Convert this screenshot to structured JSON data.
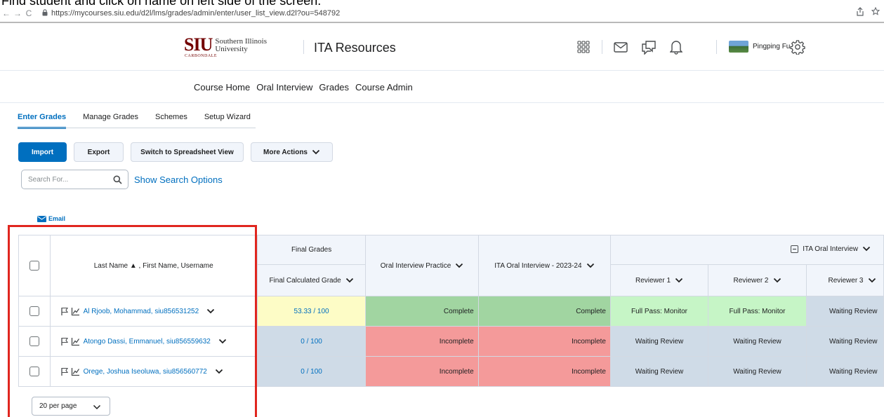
{
  "caption": "Find student and click on name on left side of the screen.",
  "browser": {
    "back": "←",
    "forward": "→",
    "reload": "C",
    "url": "https://mycourses.siu.edu/d2l/lms/grades/admin/enter/user_list_view.d2l?ou=548792"
  },
  "header": {
    "logo_main": "SIU",
    "logo_sub": "CARBONDALE",
    "logo_line1": "Southern Illinois",
    "logo_line2": "University",
    "course_name": "ITA Resources",
    "user_name": "Pingping Fu"
  },
  "navbar": {
    "items": [
      "Course Home",
      "Oral Interview",
      "Grades",
      "Course Admin"
    ]
  },
  "subtabs": {
    "items": [
      "Enter Grades",
      "Manage Grades",
      "Schemes",
      "Setup Wizard"
    ]
  },
  "toolbar": {
    "import": "Import",
    "export": "Export",
    "spreadsheet": "Switch to Spreadsheet View",
    "more_actions": "More Actions"
  },
  "search": {
    "placeholder": "Search For...",
    "show_options": "Show Search Options"
  },
  "email": "Email",
  "table": {
    "name_header": "Last Name ▲ , First Name, Username",
    "final_grades": "Final Grades",
    "final_calc": "Final Calculated Grade",
    "col_practice": "Oral Interview Practice",
    "col_ita": "ITA Oral Interview - 2023-24",
    "group_header": "ITA Oral Interview",
    "reviewer1": "Reviewer 1",
    "reviewer2": "Reviewer 2",
    "reviewer3": "Reviewer 3",
    "rows": [
      {
        "name": "Al Rjoob, Mohammad, siu856531252",
        "grade": "53.33 / 100",
        "practice": "Complete",
        "ita": "Complete",
        "r1": "Full Pass: Monitor",
        "r2": "Full Pass: Monitor",
        "r3": "Waiting Review"
      },
      {
        "name": "Atongo Dassi, Emmanuel, siu856559632",
        "grade": "0 / 100",
        "practice": "Incomplete",
        "ita": "Incomplete",
        "r1": "Waiting Review",
        "r2": "Waiting Review",
        "r3": "Waiting Review"
      },
      {
        "name": "Orege, Joshua Iseoluwa, siu856560772",
        "grade": "0 / 100",
        "practice": "Incomplete",
        "ita": "Incomplete",
        "r1": "Waiting Review",
        "r2": "Waiting Review",
        "r3": "Waiting Review"
      }
    ]
  },
  "pagination": {
    "per_page": "20 per page"
  }
}
